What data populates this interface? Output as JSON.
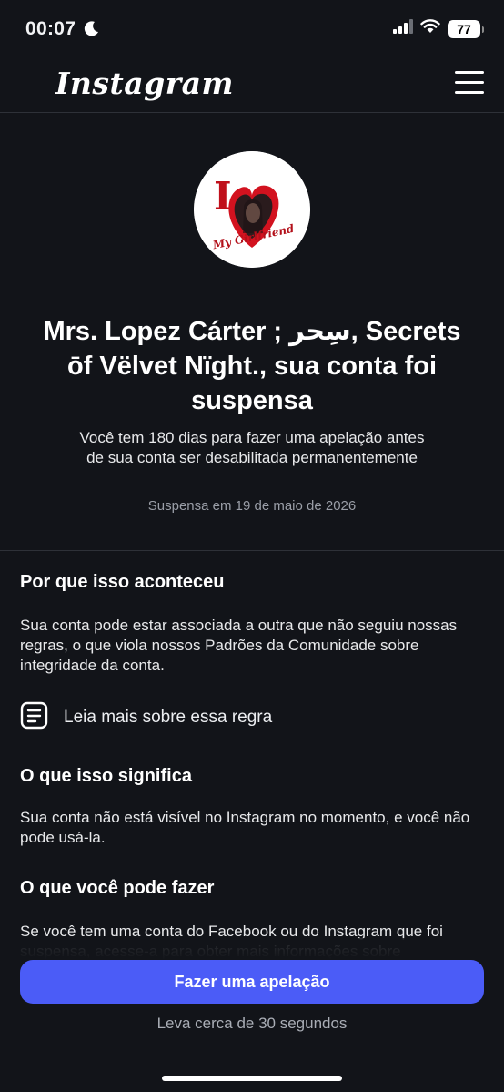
{
  "status_bar": {
    "time": "00:07",
    "battery": "77"
  },
  "nav": {
    "logo": "Instagram"
  },
  "avatar": {
    "top_text": "I",
    "bottom_text": "My Girlfriend"
  },
  "suspension": {
    "title": "Mrs. Lopez Cárter ;  سِحر, Secrets ōf Vëlvet Nïght., sua conta foi suspensa",
    "subtitle": "Você tem 180 dias para fazer uma apelação antes de sua conta ser desabilitada permanentemente",
    "date": "Suspensa em 19 de maio de 2026"
  },
  "sections": {
    "why_title": "Por que isso aconteceu",
    "why_body": "Sua conta pode estar associada a outra que não seguiu nossas regras, o que viola nossos Padrões da Comunidade sobre integridade da conta.",
    "rule_link": "Leia mais sobre essa regra",
    "meaning_title": "O que isso significa",
    "meaning_body": "Sua conta não está visível no Instagram no momento, e você não pode usá-la.",
    "todo_title": "O que você pode fazer",
    "todo_body": "Se você tem uma conta do Facebook ou do Instagram que foi suspensa, acesse-a para obter mais informações sobre"
  },
  "footer": {
    "appeal_button": "Fazer uma apelação",
    "hint": "Leva cerca de 30 segundos"
  },
  "colors": {
    "background": "#121419",
    "accent": "#4b5cf7"
  }
}
